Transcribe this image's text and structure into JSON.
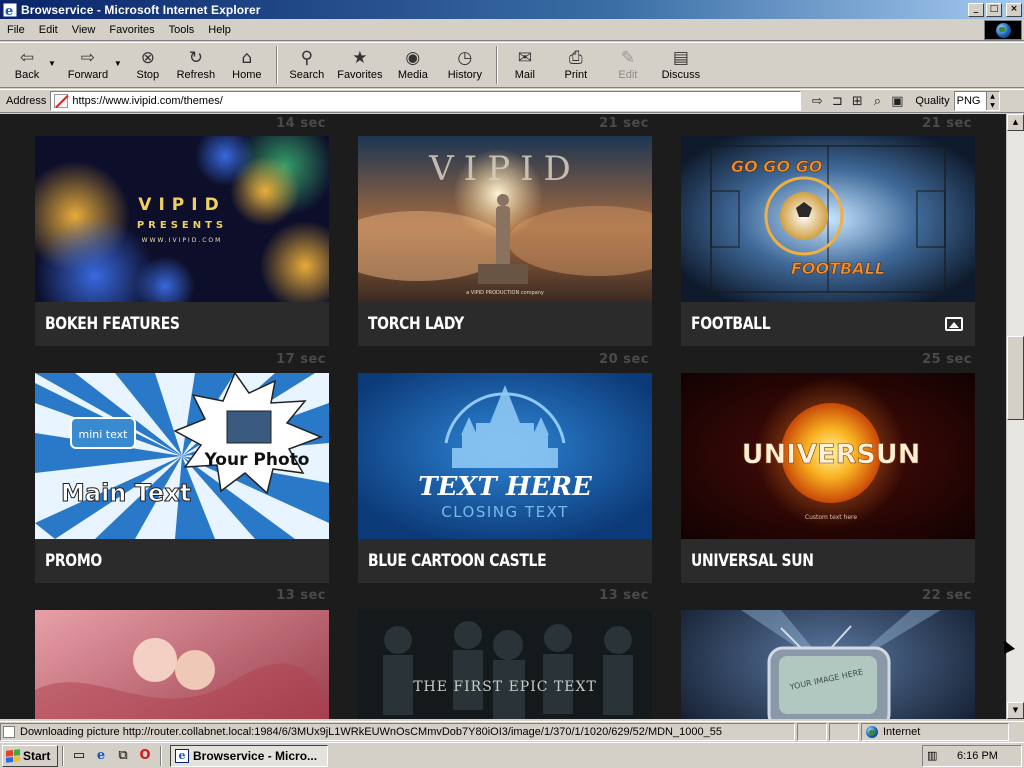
{
  "window": {
    "title": "Browservice - Microsoft Internet Explorer",
    "buttons": [
      "_",
      "□",
      "×"
    ]
  },
  "menu": [
    "File",
    "Edit",
    "View",
    "Favorites",
    "Tools",
    "Help"
  ],
  "toolbar": {
    "back": "Back",
    "forward": "Forward",
    "stop": "Stop",
    "refresh": "Refresh",
    "home": "Home",
    "search": "Search",
    "favorites": "Favorites",
    "media": "Media",
    "history": "History",
    "mail": "Mail",
    "print": "Print",
    "edit": "Edit",
    "discuss": "Discuss"
  },
  "address": {
    "label": "Address",
    "url": "https://www.ivipid.com/themes/",
    "quality_label": "Quality",
    "quality_value": "PNG"
  },
  "themes": [
    {
      "duration": "14 sec",
      "title": "BOKEH FEATURES",
      "thumb": {
        "brand": "VIPID",
        "sub": "PRESENTS",
        "site": "WWW.IVIPID.COM"
      }
    },
    {
      "duration": "21 sec",
      "title": "TORCH LADY",
      "thumb": {
        "brand": "VIPID",
        "sub": "a VIPID PRODUCTION company"
      }
    },
    {
      "duration": "21 sec",
      "title": "FOOTBALL",
      "thumb": {
        "top": "GO GO GO",
        "bottom": "FOOTBALL"
      },
      "icon": "image-icon"
    },
    {
      "duration": "17 sec",
      "title": "PROMO",
      "thumb": {
        "mini": "mini text",
        "photo": "Your Photo",
        "main": "Main Text"
      }
    },
    {
      "duration": "20 sec",
      "title": "BLUE CARTOON CASTLE",
      "thumb": {
        "main": "TEXT HERE",
        "sub": "CLOSING TEXT"
      }
    },
    {
      "duration": "25 sec",
      "title": "UNIVERSAL SUN",
      "thumb": {
        "main": "UNIVERSUN",
        "sub": "Custom text here"
      }
    },
    {
      "duration": "13 sec",
      "title": "",
      "thumb": {}
    },
    {
      "duration": "13 sec",
      "title": "",
      "thumb": {
        "main": "THE FIRST EPIC TEXT"
      }
    },
    {
      "duration": "22 sec",
      "title": "",
      "thumb": {
        "main": "YOUR IMAGE HERE"
      }
    }
  ],
  "status": {
    "text": "Downloading picture http://router.collabnet.local:1984/6/3MUx9jL1WRkEUWnOsCMmvDob7Y80iOI3/image/1/370/1/1020/629/52/MDN_1000_55",
    "zone": "Internet"
  },
  "taskbar": {
    "start": "Start",
    "task": "Browservice - Micro...",
    "clock": "6:16 PM"
  },
  "colors": {
    "page_bg": "#1c1c1c",
    "card_label_bg": "#2b2b2b",
    "titlebar_start": "#0a246a",
    "titlebar_end": "#a6caf0"
  }
}
